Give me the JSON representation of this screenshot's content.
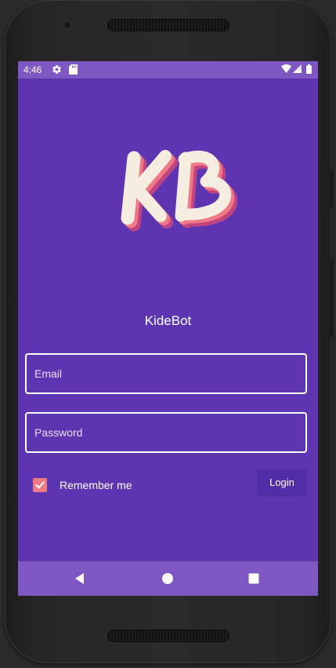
{
  "status_bar": {
    "time": "4:46",
    "icons": [
      "gear-icon",
      "sd-card-icon",
      "wifi-icon",
      "signal-icon",
      "battery-icon"
    ]
  },
  "logo": {
    "text": "KB",
    "colors": {
      "fill": "#f5ede0",
      "shadow1": "#ef7a85",
      "shadow2": "#c0447f"
    }
  },
  "app": {
    "name": "KideBot"
  },
  "form": {
    "email_placeholder": "Email",
    "email_value": "",
    "password_placeholder": "Password",
    "password_value": "",
    "remember_label": "Remember me",
    "remember_checked": true,
    "login_label": "Login"
  },
  "nav_bar": {
    "buttons": [
      "back-icon",
      "home-icon",
      "recents-icon"
    ]
  },
  "colors": {
    "screen_bg": "#5e35b1",
    "bars_bg": "#7e57c2",
    "button_bg": "#512da8",
    "checkbox": "#ef7a85"
  }
}
